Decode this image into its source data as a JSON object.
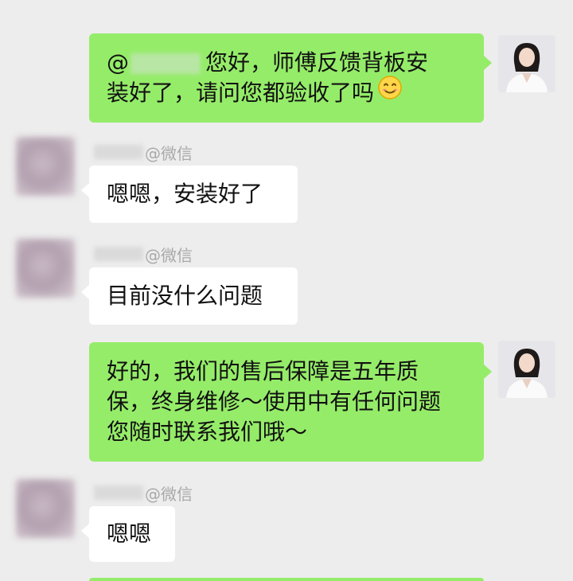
{
  "messages": [
    {
      "side": "self",
      "mention_prefix": "@",
      "lines": [
        "您好，师傅反馈背板安",
        "装好了，请问您都验收了吗"
      ],
      "emoji": "smile-icon"
    },
    {
      "side": "other",
      "sender_suffix": "@微信",
      "text": "嗯嗯，安装好了"
    },
    {
      "side": "other",
      "sender_suffix": "@微信",
      "text": "目前没什么问题"
    },
    {
      "side": "self",
      "lines": [
        "好的，我们的售后保障是五年质",
        "保，终身维修～使用中有任何问题",
        "您随时联系我们哦～"
      ]
    },
    {
      "side": "other",
      "sender_suffix": "@微信",
      "text": "嗯嗯"
    }
  ],
  "colors": {
    "background": "#ededed",
    "self_bubble": "#95ec69",
    "other_bubble": "#ffffff",
    "sender_text": "#a9a9a9"
  }
}
